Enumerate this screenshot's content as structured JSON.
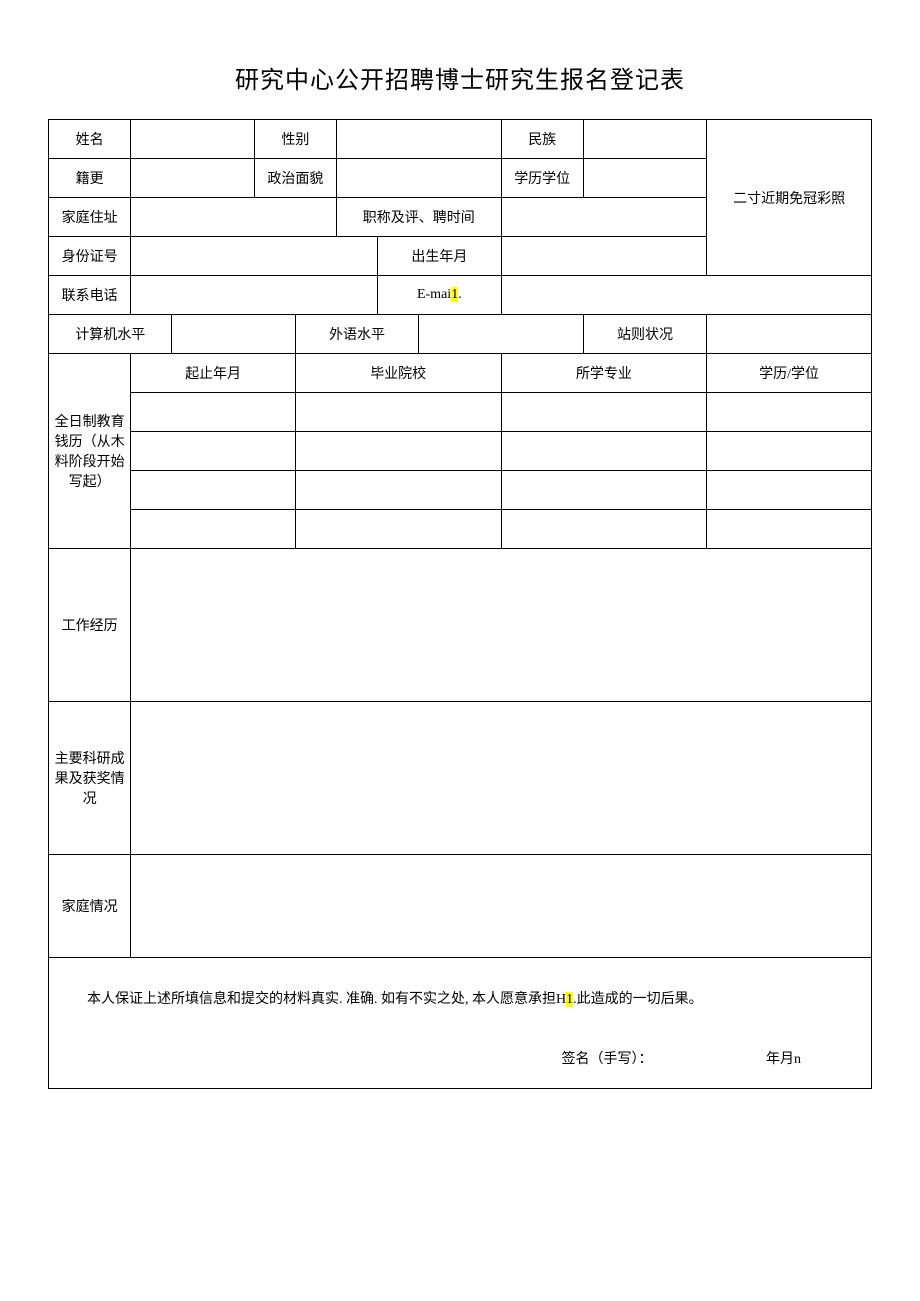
{
  "title": "研究中心公开招聘博士研究生报名登记表",
  "labels": {
    "name": "姓名",
    "gender": "性别",
    "ethnicity": "民族",
    "native": "籍更",
    "political": "政治面貌",
    "edu_degree": "学历学位",
    "address": "家庭住址",
    "title_eval_time": "职称及评、聘时间",
    "photo": "二寸近期免冠彩照",
    "idnum": "身份证号",
    "birth": "出生年月",
    "phone": "联系电话",
    "email_pre": "E-mai",
    "email_hl": "1",
    "email_post": ".",
    "computer": "计算机水平",
    "foreign_lang": "外语水平",
    "station_status": "站则状况",
    "edu_block": "全日制教育钱历（从木料阶段开始写起）",
    "col_period": "起止年月",
    "col_school": "毕业院校",
    "col_major": "所学专业",
    "col_degree": "学历/学位",
    "work_history": "工作经历",
    "research_awards": "主要科研成果及获奖情况",
    "family": "家庭情况",
    "declaration_pre": "本人保证上述所填信息和提交的材料真实. 准确. 如有不实之处, 本人愿意承担H",
    "declaration_hl": "1",
    "declaration_post": ".此造成的一切后果。",
    "sign_label": "签名（手写）：",
    "date_label": "年月n"
  }
}
